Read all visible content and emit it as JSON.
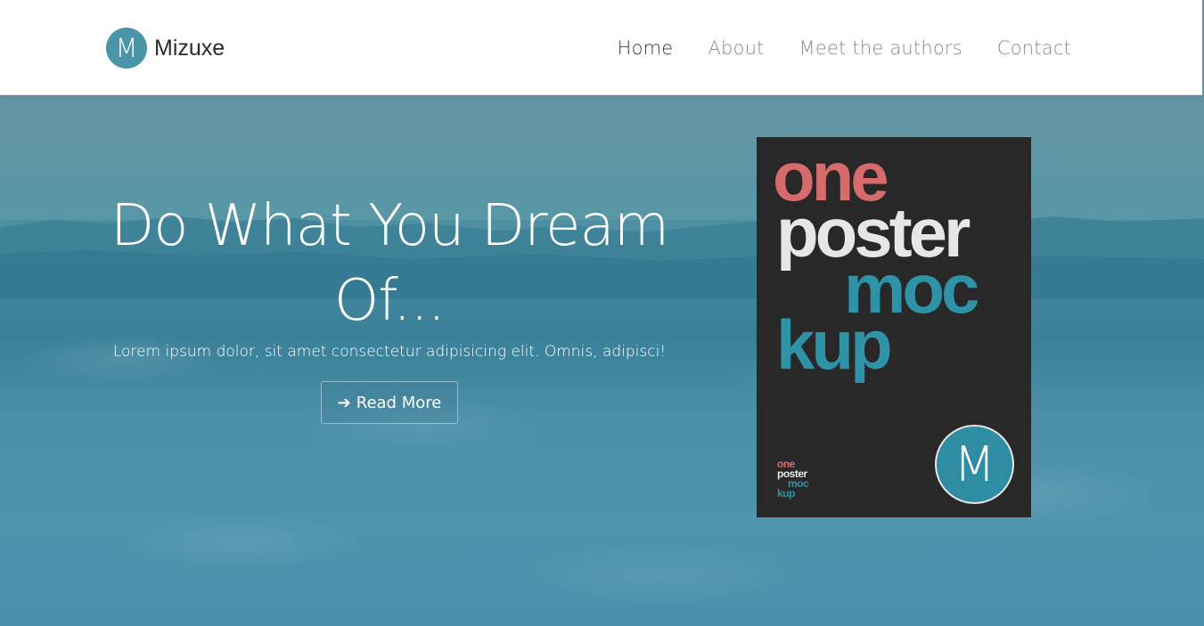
{
  "brand": {
    "logo_letter": "M",
    "name": "Mizuxe"
  },
  "nav": {
    "items": [
      {
        "label": "Home",
        "active": true
      },
      {
        "label": "About",
        "active": false
      },
      {
        "label": "Meet the authors",
        "active": false
      },
      {
        "label": "Contact",
        "active": false
      }
    ]
  },
  "hero": {
    "title": "Do What You Dream Of...",
    "subtitle": "Lorem ipsum dolor, sit amet consectetur adipisicing elit. Omnis, adipisci!",
    "button_label": "Read More",
    "button_icon": "arrow-right-icon"
  },
  "poster": {
    "words": [
      "one",
      "poster",
      "moc",
      "kup"
    ],
    "logo_letter": "M"
  },
  "colors": {
    "accent": "#4a96a8",
    "poster_bg": "#282828",
    "poster_red": "#d66b6b",
    "poster_teal": "#2f93a8"
  }
}
